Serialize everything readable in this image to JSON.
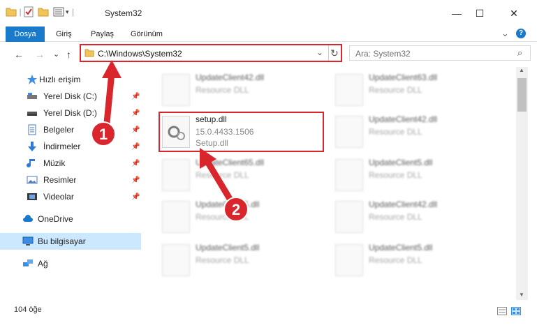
{
  "window": {
    "title": "System32",
    "minimize_glyph": "—",
    "maximize_glyph": "☐",
    "close_glyph": "✕",
    "help_glyph": "?",
    "expand_ribbon_glyph": "⌄"
  },
  "ribbon": {
    "tabs": [
      "Dosya",
      "Giriş",
      "Paylaş",
      "Görünüm"
    ]
  },
  "navigation": {
    "back_glyph": "←",
    "forward_glyph": "→",
    "history_glyph": "⌄",
    "up_glyph": "↑",
    "address": "C:\\Windows\\System32",
    "dropdown_glyph": "⌄",
    "refresh_glyph": "↻",
    "search_placeholder": "Ara: System32",
    "search_glyph": "⌕"
  },
  "sidebar": {
    "items": [
      {
        "label": "Hızlı erişim",
        "icon": "star-icon",
        "pinned": false
      },
      {
        "label": "Yerel Disk (C:)",
        "icon": "drive-icon",
        "pinned": true
      },
      {
        "label": "Yerel Disk (D:)",
        "icon": "drive-icon",
        "pinned": true
      },
      {
        "label": "Belgeler",
        "icon": "documents-icon",
        "pinned": true
      },
      {
        "label": "İndirmeler",
        "icon": "download-icon",
        "pinned": true
      },
      {
        "label": "Müzik",
        "icon": "music-icon",
        "pinned": true
      },
      {
        "label": "Resimler",
        "icon": "pictures-icon",
        "pinned": true
      },
      {
        "label": "Videolar",
        "icon": "videos-icon",
        "pinned": true
      },
      {
        "label": "OneDrive",
        "icon": "cloud-icon",
        "pinned": false
      },
      {
        "label": "Bu bilgisayar",
        "icon": "computer-icon",
        "pinned": false,
        "selected": true
      },
      {
        "label": "Ağ",
        "icon": "network-icon",
        "pinned": false
      }
    ],
    "pin_glyph": "📌"
  },
  "files": {
    "left_column": [
      {
        "name": "UpdateClient42.dll",
        "type": "Resource DLL"
      },
      {
        "name": "setup.dll",
        "version": "15.0.4433.1506",
        "description": "Setup.dll"
      },
      {
        "name": "UpdateClient65.dll",
        "type": "Resource DLL"
      },
      {
        "name": "UpdateClient5.dll",
        "type": "Resource DLL"
      },
      {
        "name": "UpdateClient5.dll",
        "type": "Resource DLL"
      }
    ],
    "right_column": [
      {
        "name": "UpdateClient63.dll",
        "type": "Resource DLL"
      },
      {
        "name": "UpdateClient42.dll",
        "type": "Resource DLL"
      },
      {
        "name": "UpdateClient5.dll",
        "type": "Resource DLL"
      },
      {
        "name": "UpdateClient42.dll",
        "type": "Resource DLL"
      },
      {
        "name": "UpdateClient5.dll",
        "type": "Resource DLL"
      }
    ]
  },
  "annotations": {
    "step1": "1",
    "step2": "2",
    "color": "#d9262c"
  },
  "status": {
    "item_count": "104 öğe"
  },
  "colors": {
    "accent": "#1979ca",
    "selected_bg": "#cce8ff",
    "highlight": "#d9262c"
  }
}
